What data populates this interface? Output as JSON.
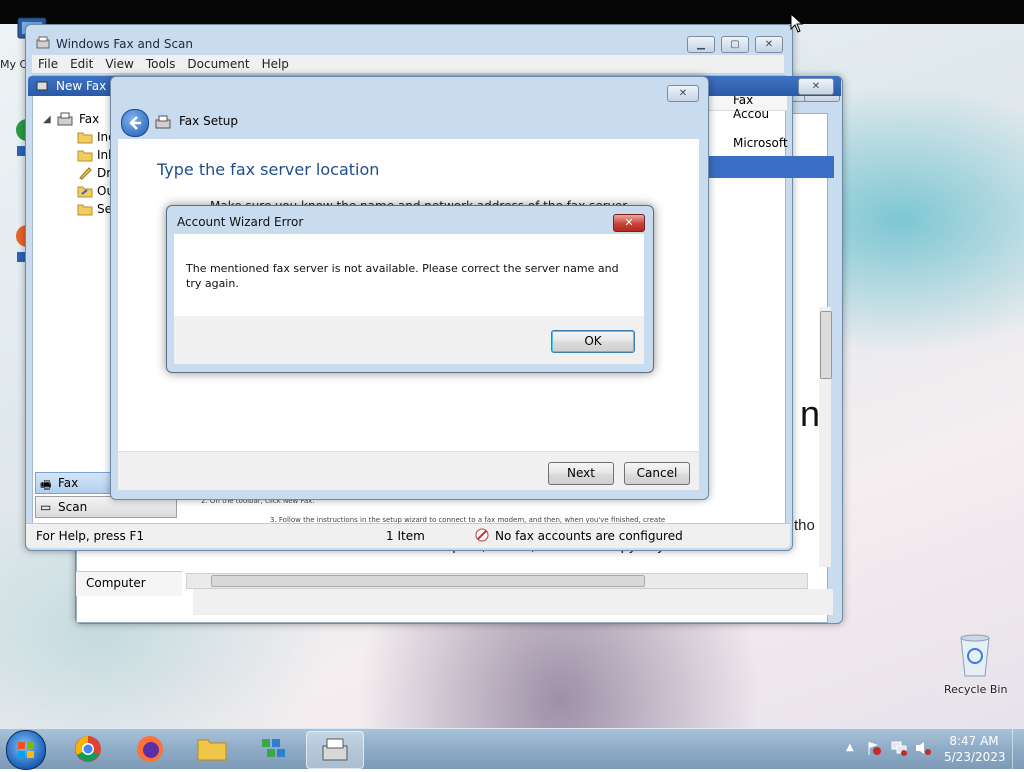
{
  "desktop": {
    "icons": [
      {
        "label": "My C"
      },
      {
        "label": "Recycle Bin"
      }
    ]
  },
  "explorer": {
    "header_col": "Fax Accou",
    "row_text": "Microsoft",
    "big_letter": "n",
    "sidebar_bottom": "Computer",
    "body_text_line": "machine. You can also print, e-mail, or save a copy of your faxes.",
    "body_text_right": "tho"
  },
  "faxscan": {
    "title": "Windows Fax and Scan",
    "menu": [
      "File",
      "Edit",
      "View",
      "Tools",
      "Document",
      "Help"
    ],
    "tree": {
      "root": "Fax",
      "children": [
        "Inc",
        "Inb",
        "Dr",
        "Ou",
        "Se"
      ]
    },
    "nav_buttons": {
      "fax": "Fax",
      "scan": "Scan"
    },
    "status": {
      "help": "For Help, press F1",
      "count": "1 Item",
      "accounts": "No fax accounts are configured"
    },
    "doc_lines": [
      "2.    On the toolbar, click New Fax.",
      "3.    Follow the instructions in the setup wizard to connect to a fax modem, and then, when you've finished, create"
    ]
  },
  "newfax": {
    "title": "New Fax"
  },
  "faxsetup": {
    "title": "Fax Setup",
    "heading": "Type the fax server location",
    "subtext": "Make sure you know the name and network address of the fax server",
    "next_label": "Next",
    "cancel_label": "Cancel"
  },
  "error_dialog": {
    "title": "Account Wizard Error",
    "message": "The mentioned fax server is not available. Please correct the server name and try again.",
    "ok_label": "OK"
  },
  "taskbar": {
    "clock_time": "8:47 AM",
    "clock_date": "5/23/2023",
    "apps": [
      "start-orb",
      "chrome",
      "firefox",
      "file-explorer",
      "network-app",
      "fax-scan"
    ]
  },
  "colors": {
    "heading_blue": "#1e4e8c",
    "taskbar": "#8eabc6",
    "close_red": "#c7433a"
  }
}
